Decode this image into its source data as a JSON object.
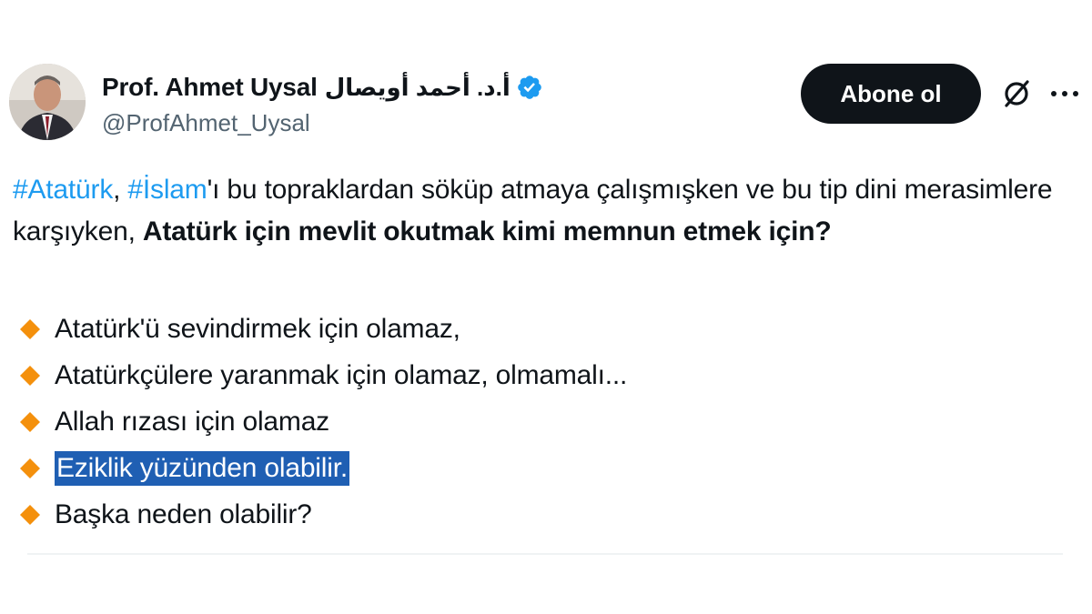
{
  "author": {
    "display_name": "Prof. Ahmet Uysal",
    "display_name_arabic": "أ.د. أحمد أويصال",
    "handle": "@ProfAhmet_Uysal",
    "verified_icon": "verified-badge-icon",
    "avatar_icon": "profile-photo"
  },
  "actions": {
    "subscribe_label": "Abone ol",
    "grok_icon": "grok-icon",
    "more_icon": "more-options-icon"
  },
  "tweet": {
    "hashtag_1": "#Atatürk",
    "sep_1": ", ",
    "hashtag_2": "#İslam",
    "text_1": "'ı bu topraklardan söküp atmaya çalışmışken ve bu tip dini merasimlere karşıyken, ",
    "bold_text": "Atatürk için mevlit okutmak kimi memnun etmek için?",
    "bullets": [
      "Atatürk'ü sevindirmek için olamaz,",
      "Atatürkçülere yaranmak için olamaz, olmamalı...",
      "Allah rızası için olamaz",
      "Eziklik yüzünden olabilir.",
      "Başka neden olabilir?"
    ],
    "bullet_icon": "orange-diamond-emoji",
    "highlighted_bullet_index": 3
  },
  "colors": {
    "hashtag": "#1d9bf0",
    "bullet_diamond": "#f4900c",
    "selection_highlight": "#1f5fb3",
    "button_bg": "#0f1419",
    "handle_gray": "#536471"
  }
}
